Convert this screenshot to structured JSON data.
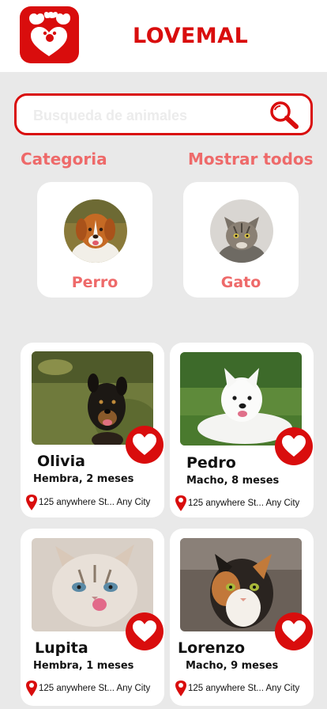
{
  "app": {
    "title": "LOVEMAL"
  },
  "search": {
    "placeholder": "Busqueda de animales"
  },
  "categories": {
    "title": "Categoria",
    "show_all": "Mostrar todos",
    "items": [
      {
        "label": "Perro"
      },
      {
        "label": "Gato"
      }
    ]
  },
  "pets": [
    {
      "name": "Olivia",
      "info": "Hembra, 2 meses",
      "location": "125 anywhere St... Any City"
    },
    {
      "name": "Pedro",
      "info": "Macho, 8 meses",
      "location": "125 anywhere St... Any City"
    },
    {
      "name": "Lupita",
      "info": "Hembra, 1 meses",
      "location": "125 anywhere St... Any City"
    },
    {
      "name": "Lorenzo",
      "info": "Macho, 9 meses",
      "location": "125 anywhere St... Any City"
    }
  ],
  "colors": {
    "accent": "#d90d0d",
    "soft_red": "#ee6a6a",
    "background": "#e9e9e9"
  },
  "icons": {
    "logo": "paw-heart-logo",
    "search": "search-icon",
    "favorite": "heart-icon",
    "location": "location-pin-icon"
  }
}
